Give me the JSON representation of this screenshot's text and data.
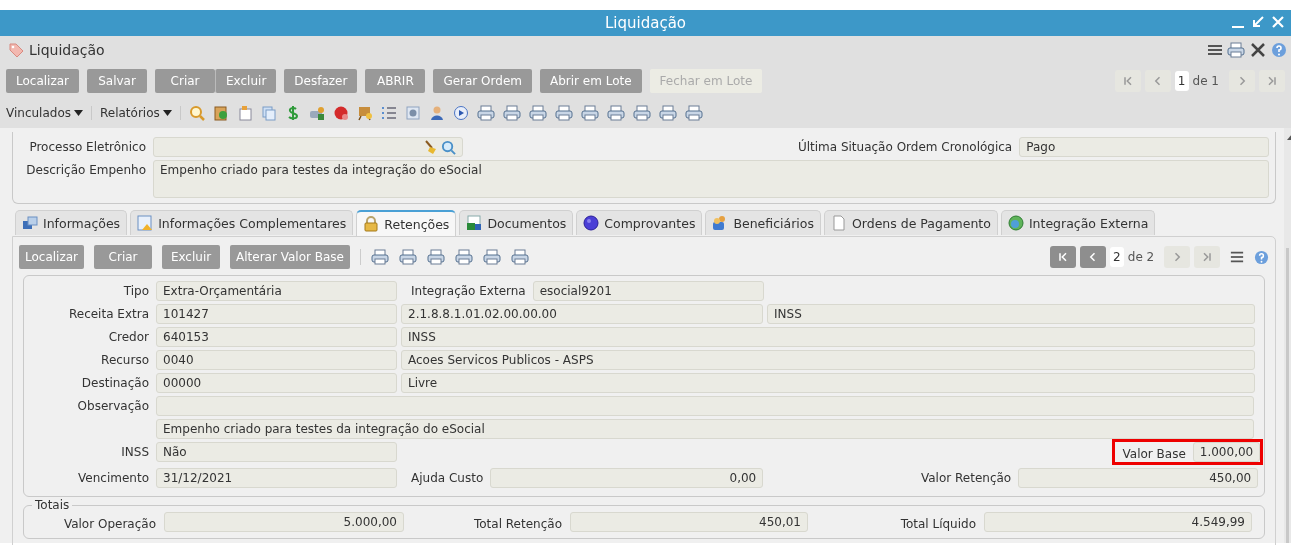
{
  "window": {
    "title": "Liquidação"
  },
  "header": {
    "title": "Liquidação"
  },
  "toolbar": {
    "buttons": [
      {
        "label": "Localizar",
        "disabled": false
      },
      {
        "label": "Salvar",
        "disabled": false
      },
      {
        "label": "Criar",
        "disabled": false
      },
      {
        "label": "Excluir",
        "disabled": false
      },
      {
        "label": "Desfazer",
        "disabled": false
      },
      {
        "label": "ABRIR",
        "disabled": false
      },
      {
        "label": "Gerar Ordem",
        "disabled": false
      },
      {
        "label": "Abrir em Lote",
        "disabled": false
      },
      {
        "label": "Fechar em Lote",
        "disabled": true
      }
    ]
  },
  "pager": {
    "back": [
      {
        "kind": "first",
        "disabled": true
      },
      {
        "kind": "prev",
        "disabled": true
      }
    ],
    "page": "1",
    "total": "de 1",
    "forward": [
      {
        "kind": "next",
        "disabled": true
      },
      {
        "kind": "last",
        "disabled": true
      }
    ]
  },
  "menus": [
    {
      "label": "Vinculados"
    },
    {
      "label": "Relatórios"
    }
  ],
  "form": {
    "processo": {
      "label": "Processo Eletrônico"
    },
    "situacao": {
      "label": "Última Situação Ordem Cronológica",
      "value": "Pago"
    },
    "descricao": {
      "label": "Descrição Empenho",
      "value": "Empenho criado para testes da integração do eSocial"
    }
  },
  "tabs": [
    {
      "label": "Informações",
      "selected": false
    },
    {
      "label": "Informações Complementares",
      "selected": false
    },
    {
      "label": "Retenções",
      "selected": true
    },
    {
      "label": "Documentos",
      "selected": false
    },
    {
      "label": "Comprovantes",
      "selected": false
    },
    {
      "label": "Beneficiários",
      "selected": false
    },
    {
      "label": "Ordens de Pagamento",
      "selected": false
    },
    {
      "label": "Integração Externa",
      "selected": false
    }
  ],
  "panel": {
    "buttons": [
      {
        "label": "Localizar",
        "disabled": false
      },
      {
        "label": "Criar",
        "disabled": false
      },
      {
        "label": "Excluir",
        "disabled": false
      },
      {
        "label": "Alterar Valor Base",
        "disabled": false
      }
    ],
    "pager": {
      "back": [
        {
          "kind": "first",
          "disabled": false
        },
        {
          "kind": "prev",
          "disabled": false
        }
      ],
      "page": "2",
      "total": "de 2",
      "forward": [
        {
          "kind": "next",
          "disabled": true
        },
        {
          "kind": "last",
          "disabled": true
        }
      ]
    },
    "rows": [
      {
        "kind": "labeled_pair",
        "label": "Tipo",
        "value": "Extra-Orçamentária",
        "label2": "Integração Externa",
        "value2": "esocial9201"
      },
      {
        "kind": "triple",
        "label": "Receita Extra",
        "values": [
          "101427",
          "2.1.8.8.1.01.02.00.00.00",
          "INSS"
        ]
      },
      {
        "kind": "double",
        "label": "Credor",
        "values": [
          "640153",
          "INSS"
        ]
      },
      {
        "kind": "double",
        "label": "Recurso",
        "values": [
          "0040",
          "Acoes Servicos Publicos - ASPS"
        ]
      },
      {
        "kind": "double",
        "label": "Destinação",
        "values": [
          "00000",
          "Livre"
        ]
      },
      {
        "kind": "wide",
        "label": "Observação"
      },
      {
        "kind": "wide",
        "value": "Empenho criado para testes da integração do eSocial"
      },
      {
        "kind": "base",
        "label": "INSS",
        "value": "Não",
        "label2": "Valor Base",
        "value2": "1.000,00",
        "highlighted": true
      },
      {
        "kind": "due",
        "label": "Vencimento",
        "value": "31/12/2021",
        "label2": "Ajuda Custo",
        "value2": "0,00",
        "label3": "Valor Retenção",
        "value3": "450,00"
      }
    ],
    "totals": {
      "legend": "Totais",
      "items": [
        {
          "label": "Valor Operação",
          "value": "5.000,00"
        },
        {
          "label": "Total Retenção",
          "value": "450,01"
        },
        {
          "label": "Total Líquido",
          "value": "4.549,99"
        }
      ]
    }
  }
}
